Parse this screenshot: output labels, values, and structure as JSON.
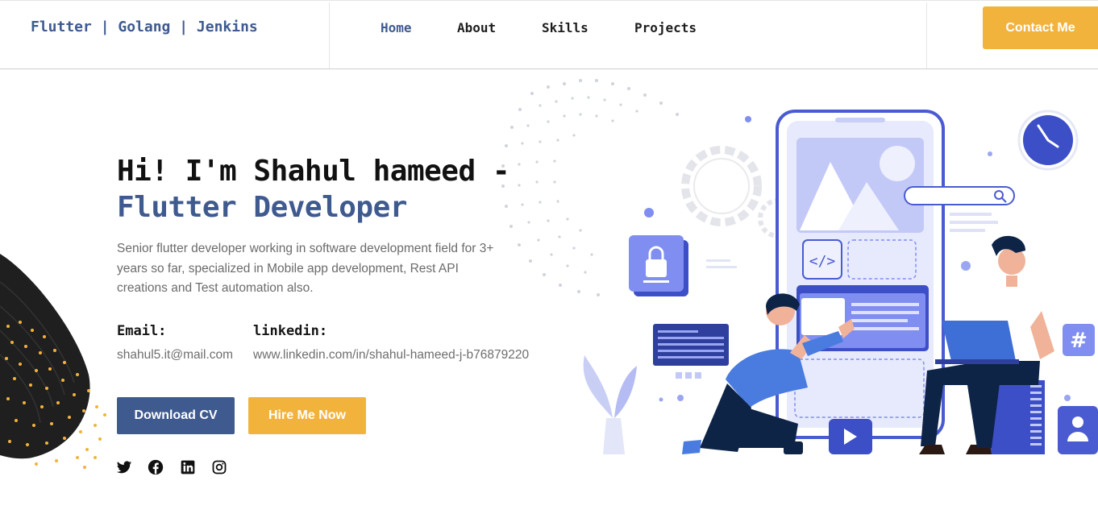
{
  "header": {
    "brand": "Flutter | Golang | Jenkins",
    "nav": [
      "Home",
      "About",
      "Skills",
      "Projects"
    ],
    "active_nav": "Home",
    "contact_label": "Contact Me"
  },
  "hero": {
    "title_line1": "Hi! I'm Shahul hameed -",
    "title_line2": "Flutter Developer",
    "description": "Senior flutter developer working in software development field for 3+ years so far, specialized in Mobile app development, Rest API creations and Test automation also.",
    "email_label": "Email:",
    "email_value": "shahul5.it@mail.com",
    "linkedin_label": "linkedin:",
    "linkedin_value": "www.linkedin.com/in/shahul-hameed-j-b76879220",
    "download_label": "Download CV",
    "hire_label": "Hire Me Now"
  },
  "social_icons": [
    "twitter-icon",
    "facebook-icon",
    "linkedin-icon",
    "instagram-icon"
  ],
  "colors": {
    "primary": "#3f5a8f",
    "accent": "#f2b33d",
    "illustration_blue": "#5a6fd6",
    "text_muted": "#6b6b6b"
  }
}
